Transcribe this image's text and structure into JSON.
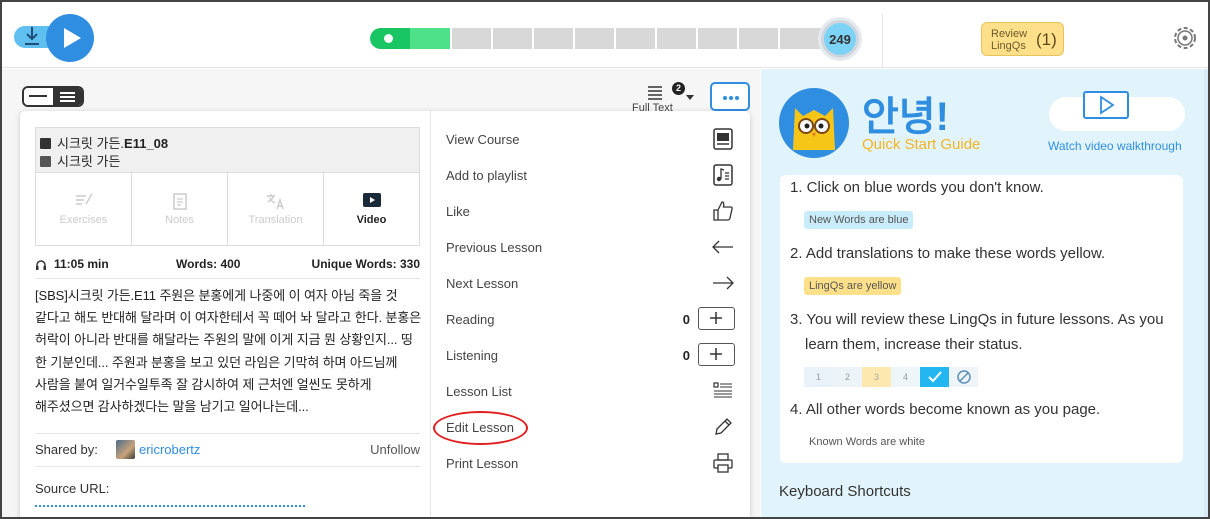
{
  "player": {
    "progress_count": "249",
    "review": {
      "label": "Review LingQs",
      "count": "(1)"
    }
  },
  "view": {
    "full_text_label": "Full Text",
    "full_text_badge": "2"
  },
  "lesson": {
    "title_prefix": "시크릿 가든.",
    "title_code": "E11_08",
    "course": "시크릿 가든",
    "tabs": [
      "Exercises",
      "Notes",
      "Translation",
      "Video"
    ],
    "duration": "11:05 min",
    "words": "Words: 400",
    "unique_words": "Unique Words: 330",
    "description": "[SBS]시크릿 가든.E11 주원은 분홍에게 나중에 이 여자 아님 죽을 것 같다고 해도 반대해 달라며 이 여자한테서 꼭 떼어 놔 달라고 한다. 분홍은 허락이 아니라 반대를 해달라는 주원의 말에 이게 지금 뭔 상황인지... 띵 한 기분인데... 주원과 분홍을 보고 있던 라임은 기막혀 하며 아드님께 사람을 붙여 일거수일투족 잘 감시하여 제 근처엔 얼씬도 못하게 해주셨으면 감사하겠다는 말을 남기고 일어나는데...",
    "shared_by_label": "Shared by:",
    "shared_by_user": "ericrobertz",
    "unfollow_label": "Unfollow",
    "source_url_label": "Source URL:"
  },
  "menu": {
    "items": [
      {
        "label": "View Course",
        "icon": "course-icon"
      },
      {
        "label": "Add to playlist",
        "icon": "playlist-icon"
      },
      {
        "label": "Like",
        "icon": "thumbs-up-icon"
      },
      {
        "label": "Previous Lesson",
        "icon": "arrow-left-icon"
      },
      {
        "label": "Next Lesson",
        "icon": "arrow-right-icon"
      },
      {
        "label": "Reading",
        "count": "0",
        "icon": "plus-icon"
      },
      {
        "label": "Listening",
        "count": "0",
        "icon": "plus-icon"
      },
      {
        "label": "Lesson List",
        "icon": "list-icon"
      },
      {
        "label": "Edit Lesson",
        "icon": "pencil-icon",
        "highlighted": true
      },
      {
        "label": "Print Lesson",
        "icon": "printer-icon"
      }
    ]
  },
  "guide": {
    "greeting": "안녕!",
    "subtitle": "Quick Start Guide",
    "video_link": "Watch video walkthrough",
    "steps": [
      "1. Click on blue words you don't know.",
      "2. Add translations to make these words yellow.",
      "3. You will review these LingQs in future lessons. As you learn them, increase their status.",
      "4. All other words become known as you page."
    ],
    "chips": {
      "new_words": "New Words are blue",
      "lingqs": "LingQs are yellow",
      "known": "Known Words are white"
    },
    "status_scale": [
      "1",
      "2",
      "3",
      "4"
    ],
    "shortcuts_title": "Keyboard Shortcuts"
  },
  "colors": {
    "accent": "#2f8ee0",
    "progress_green": "#19c663",
    "lingq_yellow": "#ffe08a",
    "new_word_blue": "#c9ecfa",
    "guide_bg": "#e2f4fb",
    "annotation_red": "#e02020"
  }
}
